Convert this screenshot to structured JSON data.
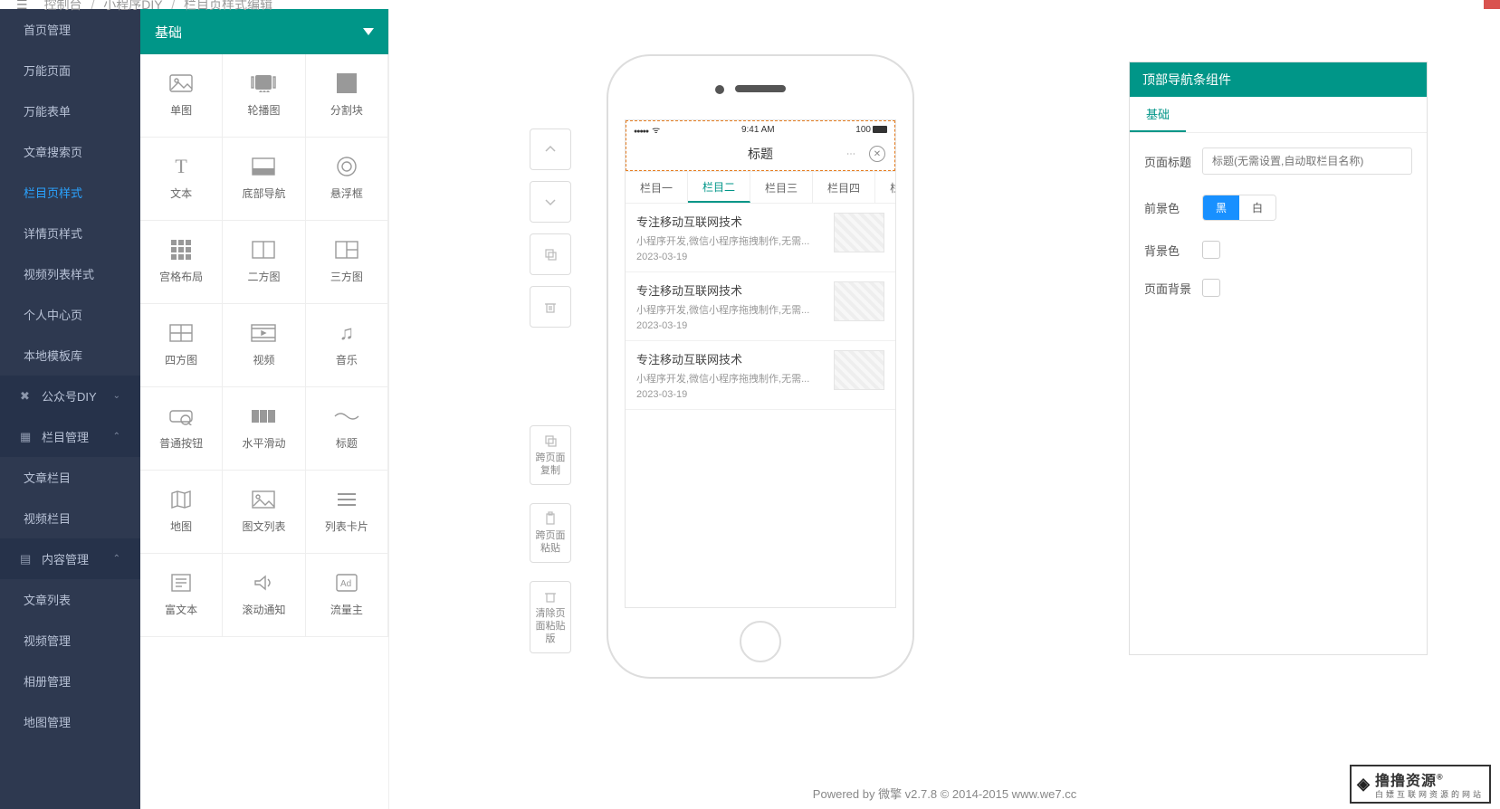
{
  "breadcrumb": {
    "root": "控制台",
    "mid": "小程序DIY",
    "leaf": "栏目页样式编辑"
  },
  "sidebar": {
    "items": [
      {
        "label": "首页管理",
        "type": "sub"
      },
      {
        "label": "万能页面",
        "type": "sub"
      },
      {
        "label": "万能表单",
        "type": "sub"
      },
      {
        "label": "文章搜索页",
        "type": "sub"
      },
      {
        "label": "栏目页样式",
        "type": "sub",
        "active": true
      },
      {
        "label": "详情页样式",
        "type": "sub"
      },
      {
        "label": "视频列表样式",
        "type": "sub"
      },
      {
        "label": "个人中心页",
        "type": "sub"
      },
      {
        "label": "本地模板库",
        "type": "sub"
      },
      {
        "label": "公众号DIY",
        "type": "section",
        "icon": "wrench",
        "chev": "down"
      },
      {
        "label": "栏目管理",
        "type": "section",
        "icon": "grid",
        "chev": "up"
      },
      {
        "label": "文章栏目",
        "type": "sub"
      },
      {
        "label": "视频栏目",
        "type": "sub"
      },
      {
        "label": "内容管理",
        "type": "section",
        "icon": "doc",
        "chev": "up"
      },
      {
        "label": "文章列表",
        "type": "sub"
      },
      {
        "label": "视频管理",
        "type": "sub"
      },
      {
        "label": "相册管理",
        "type": "sub"
      },
      {
        "label": "地图管理",
        "type": "sub"
      }
    ]
  },
  "comp_header": "基础",
  "components": [
    {
      "label": "单图",
      "icon": "image"
    },
    {
      "label": "轮播图",
      "icon": "carousel"
    },
    {
      "label": "分割块",
      "icon": "block"
    },
    {
      "label": "文本",
      "icon": "text"
    },
    {
      "label": "底部导航",
      "icon": "bottomnav"
    },
    {
      "label": "悬浮框",
      "icon": "float"
    },
    {
      "label": "宫格布局",
      "icon": "grid9"
    },
    {
      "label": "二方图",
      "icon": "grid2"
    },
    {
      "label": "三方图",
      "icon": "grid3"
    },
    {
      "label": "四方图",
      "icon": "grid4"
    },
    {
      "label": "视频",
      "icon": "video"
    },
    {
      "label": "音乐",
      "icon": "music"
    },
    {
      "label": "普通按钮",
      "icon": "button"
    },
    {
      "label": "水平滑动",
      "icon": "hscroll"
    },
    {
      "label": "标题",
      "icon": "wave"
    },
    {
      "label": "地图",
      "icon": "map"
    },
    {
      "label": "图文列表",
      "icon": "imglist"
    },
    {
      "label": "列表卡片",
      "icon": "listcard"
    },
    {
      "label": "富文本",
      "icon": "rich"
    },
    {
      "label": "滚动通知",
      "icon": "notice"
    },
    {
      "label": "流量主",
      "icon": "ad"
    }
  ],
  "actions": {
    "copy": "跨页面复制",
    "paste": "跨页面粘贴",
    "clear": "清除页面粘贴版"
  },
  "phone": {
    "status": {
      "time": "9:41 AM",
      "battery": "100"
    },
    "title": "标题",
    "tabs": [
      "栏目一",
      "栏目二",
      "栏目三",
      "栏目四",
      "栏"
    ],
    "active_tab": 1,
    "list": [
      {
        "title": "专注移动互联网技术",
        "desc": "小程序开发,微信小程序拖拽制作,无需...",
        "date": "2023-03-19"
      },
      {
        "title": "专注移动互联网技术",
        "desc": "小程序开发,微信小程序拖拽制作,无需...",
        "date": "2023-03-19"
      },
      {
        "title": "专注移动互联网技术",
        "desc": "小程序开发,微信小程序拖拽制作,无需...",
        "date": "2023-03-19"
      }
    ]
  },
  "props": {
    "header": "顶部导航条组件",
    "tab": "基础",
    "rows": {
      "page_title_label": "页面标题",
      "page_title_placeholder": "标题(无需设置,自动取栏目名称)",
      "fg_label": "前景色",
      "fg_black": "黑",
      "fg_white": "白",
      "bg_label": "背景色",
      "page_bg_label": "页面背景"
    }
  },
  "footer": "Powered by 微擎 v2.7.8 © 2014-2015 www.we7.cc",
  "watermark": {
    "main": "撸撸资源",
    "sub": "白嫖互联网资源的网站"
  }
}
